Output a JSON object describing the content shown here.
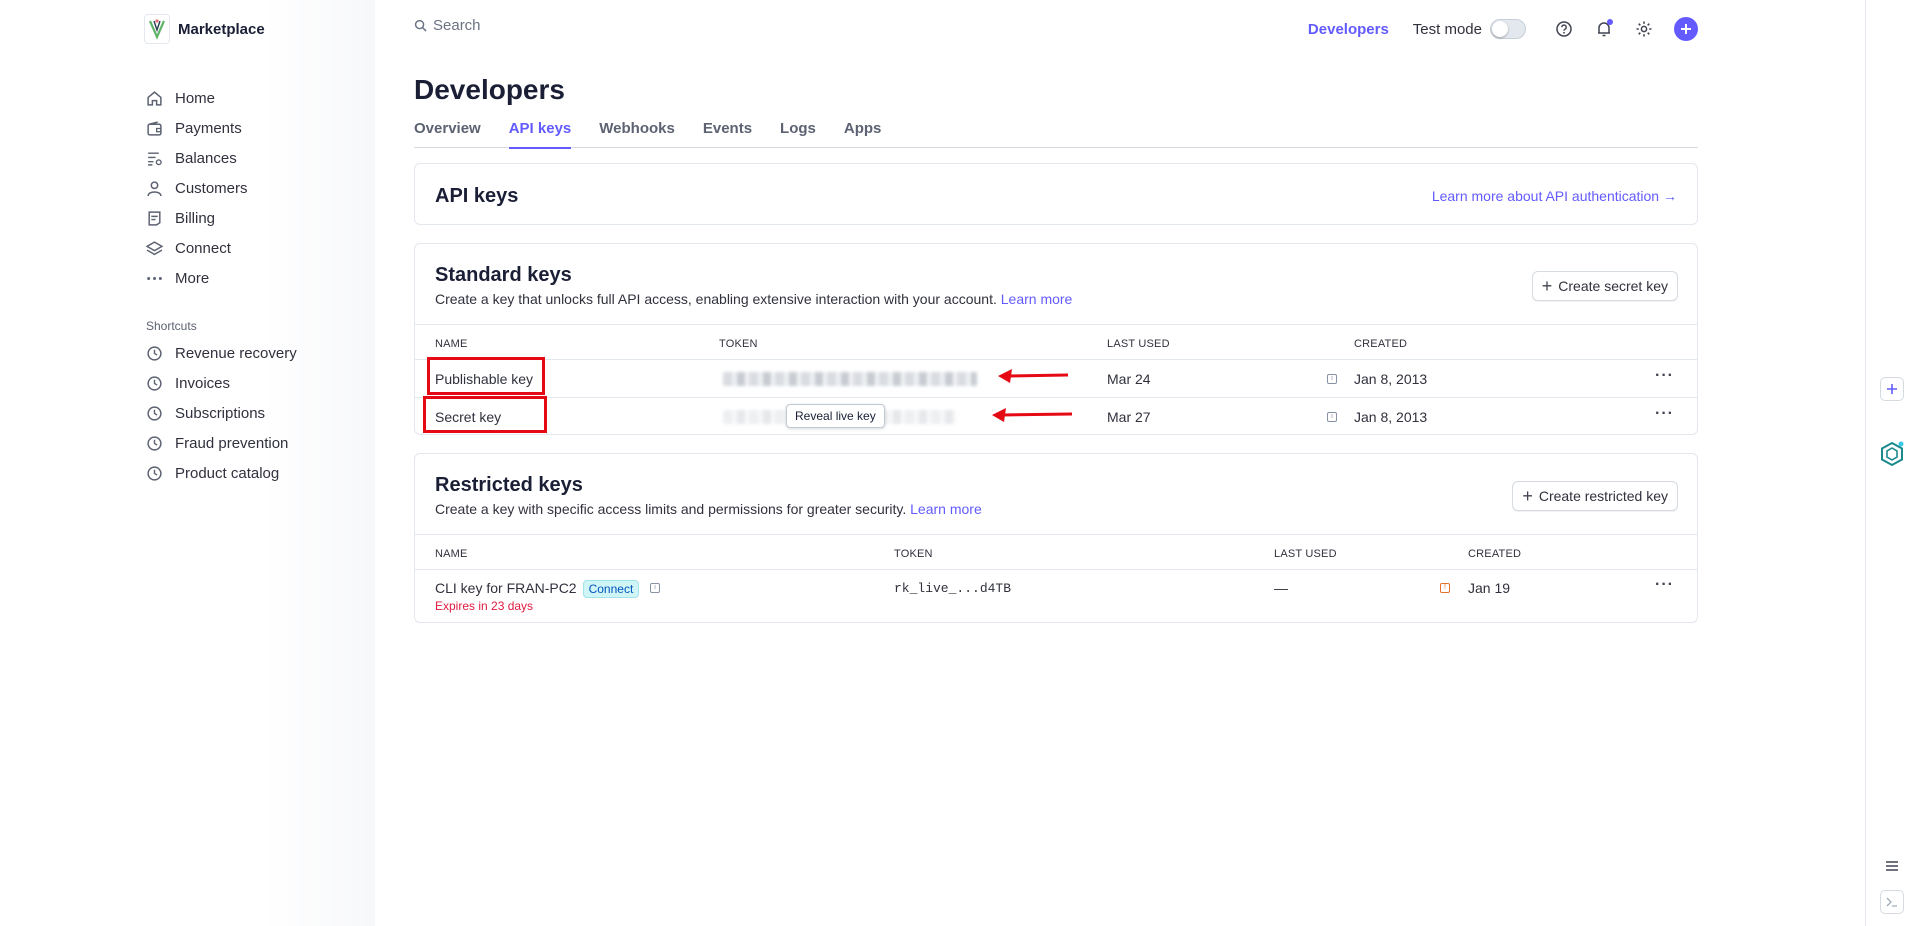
{
  "brand": {
    "name": "Marketplace"
  },
  "sidebar": {
    "items": [
      {
        "label": "Home",
        "icon": "home-icon"
      },
      {
        "label": "Payments",
        "icon": "wallet-icon"
      },
      {
        "label": "Balances",
        "icon": "balances-icon"
      },
      {
        "label": "Customers",
        "icon": "person-icon"
      },
      {
        "label": "Billing",
        "icon": "billing-icon"
      },
      {
        "label": "Connect",
        "icon": "layers-icon"
      },
      {
        "label": "More",
        "icon": "more-icon"
      }
    ],
    "shortcuts_title": "Shortcuts",
    "shortcuts": [
      {
        "label": "Revenue recovery"
      },
      {
        "label": "Invoices"
      },
      {
        "label": "Subscriptions"
      },
      {
        "label": "Fraud prevention"
      },
      {
        "label": "Product catalog"
      }
    ]
  },
  "header": {
    "search_placeholder": "Search",
    "developers": "Developers",
    "test_mode": "Test mode"
  },
  "page": {
    "title": "Developers",
    "tabs": [
      "Overview",
      "API keys",
      "Webhooks",
      "Events",
      "Logs",
      "Apps"
    ],
    "active_tab": "API keys"
  },
  "api_card": {
    "title": "API keys",
    "link": "Learn more about API authentication →"
  },
  "standard": {
    "title": "Standard keys",
    "description": "Create a key that unlocks full API access, enabling extensive interaction with your account.",
    "learn_more": "Learn more",
    "button": "Create secret key",
    "columns": [
      "NAME",
      "TOKEN",
      "LAST USED",
      "CREATED"
    ],
    "rows": [
      {
        "name": "Publishable key",
        "last_used": "Mar 24",
        "created": "Jan 8, 2013"
      },
      {
        "name": "Secret key",
        "last_used": "Mar 27",
        "created": "Jan 8, 2013"
      }
    ],
    "tooltip": "Reveal live key"
  },
  "restricted": {
    "title": "Restricted keys",
    "description": "Create a key with specific access limits and permissions for greater security.",
    "learn_more": "Learn more",
    "button": "Create restricted key",
    "columns": [
      "NAME",
      "TOKEN",
      "LAST USED",
      "CREATED"
    ],
    "rows": [
      {
        "name": "CLI key for FRAN-PC2",
        "badge": "Connect",
        "expires": "Expires in 23 days",
        "token": "rk_live_...d4TB",
        "last_used": "—",
        "created": "Jan 19"
      }
    ]
  },
  "colors": {
    "accent": "#635bff",
    "annotation": "#e50914",
    "error": "#df1b41"
  }
}
